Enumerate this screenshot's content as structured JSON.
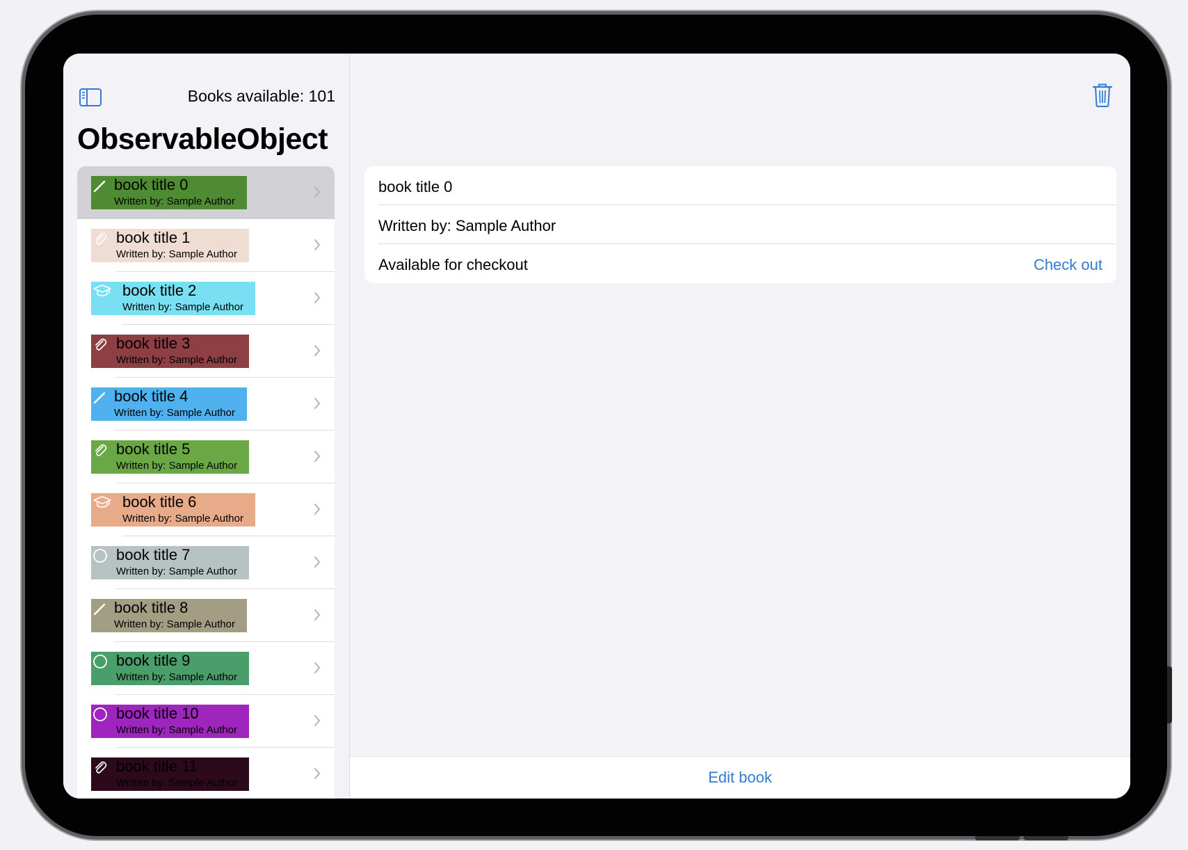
{
  "header": {
    "books_available": "Books available: 101",
    "title": "ObservableObject"
  },
  "colors": {
    "accent": "#2f7bd4",
    "selected_row": "#d1d1d6"
  },
  "books": [
    {
      "title": "book title 0",
      "author": "Written by: Sample Author",
      "color": "#4f8b33",
      "icon": "pencil-icon",
      "text_color": "#000000"
    },
    {
      "title": "book title 1",
      "author": "Written by: Sample Author",
      "color": "#efddd3",
      "icon": "paperclip-icon",
      "text_color": "#000000"
    },
    {
      "title": "book title 2",
      "author": "Written by: Sample Author",
      "color": "#79dff2",
      "icon": "graduationcap-icon",
      "text_color": "#000000"
    },
    {
      "title": "book title 3",
      "author": "Written by: Sample Author",
      "color": "#8d3f44",
      "icon": "paperclip-icon",
      "text_color": "#000000"
    },
    {
      "title": "book title 4",
      "author": "Written by: Sample Author",
      "color": "#4fb1ee",
      "icon": "pencil-icon",
      "text_color": "#000000"
    },
    {
      "title": "book title 5",
      "author": "Written by: Sample Author",
      "color": "#6aa845",
      "icon": "paperclip-icon",
      "text_color": "#000000"
    },
    {
      "title": "book title 6",
      "author": "Written by: Sample Author",
      "color": "#e8ab8a",
      "icon": "graduationcap-icon",
      "text_color": "#000000"
    },
    {
      "title": "book title 7",
      "author": "Written by: Sample Author",
      "color": "#b7c3c3",
      "icon": "circle-icon",
      "text_color": "#000000"
    },
    {
      "title": "book title 8",
      "author": "Written by: Sample Author",
      "color": "#a39d83",
      "icon": "pencil-icon",
      "text_color": "#000000"
    },
    {
      "title": "book title 9",
      "author": "Written by: Sample Author",
      "color": "#4a9e6a",
      "icon": "circle-icon",
      "text_color": "#000000"
    },
    {
      "title": "book title 10",
      "author": "Written by: Sample Author",
      "color": "#9e25be",
      "icon": "circle-icon",
      "text_color": "#000000"
    },
    {
      "title": "book title 11",
      "author": "Written by: Sample Author",
      "color": "#2c0a1b",
      "icon": "paperclip-icon",
      "text_color": "#000000"
    }
  ],
  "detail": {
    "title": "book title 0",
    "author": "Written by: Sample Author",
    "availability": "Available for checkout",
    "checkout_action": "Check out",
    "edit_action": "Edit book"
  }
}
